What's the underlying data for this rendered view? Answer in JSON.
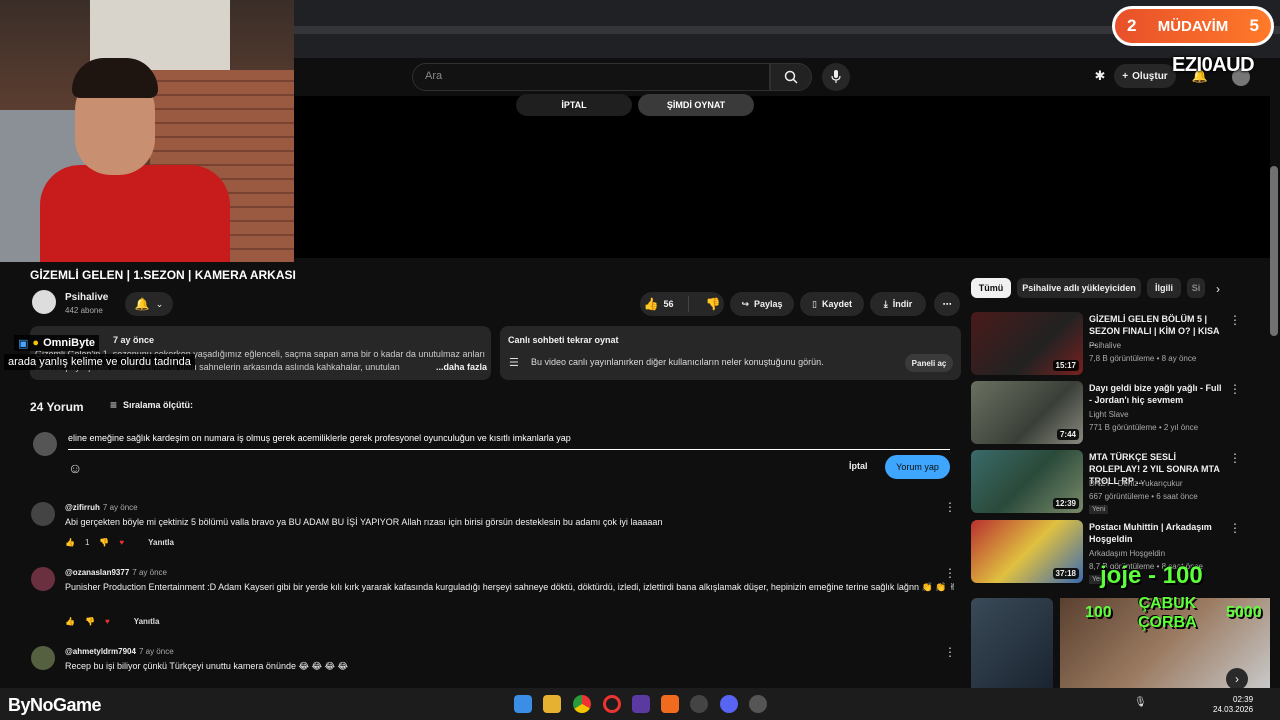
{
  "search": {
    "placeholder": "Ara"
  },
  "header": {
    "create_label": "Oluştur"
  },
  "player": {
    "cancel_label": "İPTAL",
    "play_now_label": "ŞİMDİ OYNAT"
  },
  "overlay": {
    "mudavim_left": "2",
    "mudavim_label": "MÜDAVİM",
    "mudavim_right": "5",
    "streamer_tag": "EZI0AUD",
    "joje": "joje - 100",
    "cabuk_line1": "ÇABUK",
    "cabuk_line2": "ÇORBA",
    "reward_left": "100",
    "reward_right": "5000",
    "chat_user": "OmniByte",
    "chat_message": "arada yanlış kelime ve olurdu tadında"
  },
  "video": {
    "title": "GİZEMLİ GELEN | 1.SEZON | KAMERA ARKASI",
    "channel": "Psihalive",
    "subscribers": "442 abone",
    "likes": "56",
    "share_label": "Paylaş",
    "save_label": "Kaydet",
    "download_label": "İndir"
  },
  "description": {
    "date": "7 ay önce",
    "text": "Gizemli Gelen'in 1. sezonunu çekerken yaşadığımız eğlenceli, saçma sapan ama bir o kadar da unutulmaz anları sizlerle paylaşmak istedik! Kahkaha dolu sahnelerin arkasında aslında kahkahalar, unutulan",
    "more_label": "...daha fazla"
  },
  "live_chat": {
    "title": "Canlı sohbeti tekrar oynat",
    "text": "Bu video canlı yayınlanırken diğer kullanıcıların neler konuştuğunu görün.",
    "button": "Paneli aç"
  },
  "comments": {
    "count": "24 Yorum",
    "sort_label": "Sıralama ölçütü:",
    "draft": "eline emeğine sağlık kardeşim on numara iş olmuş gerek acemiliklerle gerek profesyonel oyunculuğun ve kısıtlı imkanlarla yap",
    "cancel_label": "İptal",
    "post_label": "Yorum yap",
    "reply_label": "Yanıtla",
    "items": [
      {
        "author": "@zifirruh",
        "time": "7 ay önce",
        "text": "Abi gerçekten böyle mi çektiniz 5 bölümü valla bravo ya BU ADAM BU İŞİ YAPIYOR Allah rızası için birisi görsün desteklesin bu adamı çok iyi laaaaan",
        "likes": "1"
      },
      {
        "author": "@ozanaslan9377",
        "time": "7 ay önce",
        "text": "Punisher Production Entertainment :D Adam Kayseri gibi bir yerde kılı kırk yararak kafasında kurguladığı herşeyi sahneye döktü, döktürdü, izledi, izlettirdi bana alkışlamak düşer, hepinizin emeğine terine sağlık lağnn 👏 👏 ✌",
        "likes": ""
      },
      {
        "author": "@ahmetyldrm7904",
        "time": "7 ay önce",
        "text": "Recep bu işi biliyor çünkü Türkçeyi unuttu kamera önünde 😂 😂 😂 😂",
        "likes": ""
      }
    ]
  },
  "sidebar": {
    "chips": [
      "Tümü",
      "Psihalive adlı yükleyiciden",
      "İlgili",
      "Si"
    ],
    "videos": [
      {
        "title": "GİZEMLİ GELEN BÖLÜM 5 | SEZON FINALI | KİM O? | KISA ...",
        "channel": "Psihalive",
        "meta": "7,8 B görüntüleme • 8 ay önce",
        "duration": "15:17",
        "badge": ""
      },
      {
        "title": "Dayı geldi bize yağlı yağlı - Full - Jordan'ı hiç sevmem",
        "channel": "Light Slave",
        "meta": "771 B görüntüleme • 2 yıl önce",
        "duration": "7:44",
        "badge": ""
      },
      {
        "title": "MTA TÜRKÇE SESLİ ROLEPLAY! 2 YIL SONRA MTA TROLL RP ...",
        "channel": "DNZY - Deniz Yukarıçukur",
        "meta": "667 görüntüleme • 6 saat önce",
        "duration": "12:39",
        "badge": "Yeni"
      },
      {
        "title": "Postacı Muhittin | Arkadaşım Hoşgeldin",
        "channel": "Arkadaşım Hoşgeldin",
        "meta": "8,7 B görüntüleme • 8 saat önce",
        "duration": "37:18",
        "badge": "Yeni"
      }
    ]
  },
  "taskbar": {
    "brand": "ByNoGame",
    "time": "02:39",
    "date": "24.03.2026"
  },
  "colors": {
    "accent": "#3ea6ff",
    "overlay_green": "#5cff3a",
    "mudavim": "#ff7a2a"
  }
}
